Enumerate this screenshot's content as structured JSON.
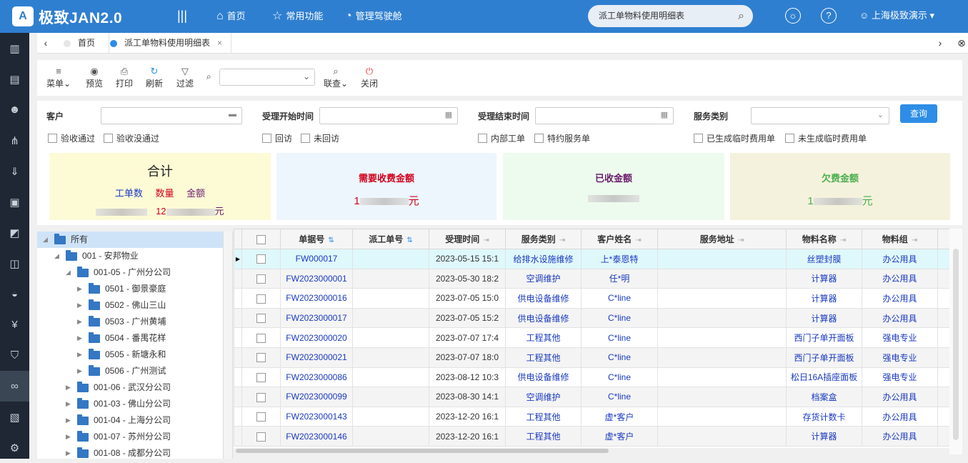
{
  "app": {
    "logo_letter": "A",
    "title": "极致JAN2.0",
    "menu_icon": "menu-lines-icon"
  },
  "topnav": [
    {
      "label": "首页",
      "icon": "home-icon",
      "glyph": "⌂"
    },
    {
      "label": "常用功能",
      "icon": "star-icon",
      "glyph": "☆"
    },
    {
      "label": "管理驾驶舱",
      "icon": "dashboard-icon",
      "glyph": "◔"
    }
  ],
  "search": {
    "value": "派工单物料使用明细表"
  },
  "user": {
    "name": "上海极致演示"
  },
  "sidebar": [
    "building-icon",
    "document-icon",
    "users-icon",
    "share-icon",
    "download-icon",
    "ticket-icon",
    "tag-icon",
    "money-icon",
    "car-icon",
    "yen-icon",
    "shield-icon",
    "link-icon",
    "file-check-icon",
    "gear-icon"
  ],
  "tabs": {
    "home": "首页",
    "current": "派工单物料使用明细表"
  },
  "toolbar": {
    "menu": "菜单",
    "preview": "预览",
    "print": "打印",
    "refresh": "刷新",
    "filter": "过滤",
    "lookup": "联查",
    "close": "关闭"
  },
  "filter": {
    "customer": "客户",
    "start_time": "受理开始时间",
    "end_time": "受理结束时间",
    "service_type": "服务类别",
    "query": "查询",
    "checks": [
      "验收通过",
      "验收没通过",
      "回访",
      "未回访",
      "内部工单",
      "特约服务单",
      "已生成临时费用单",
      "未生成临时费用单"
    ]
  },
  "cards": {
    "total": {
      "title": "合计",
      "work_orders": "工单数",
      "quantity": "数量",
      "amount": "金额",
      "qty_prefix": "12",
      "amount_suffix": "元"
    },
    "receivable": {
      "title": "需要收费金额",
      "prefix": "1",
      "suffix": "元"
    },
    "received": {
      "title": "已收金额"
    },
    "owed": {
      "title": "欠费金额",
      "prefix": "1",
      "suffix": "元"
    }
  },
  "colors": {
    "topbar": "#2f7fd0",
    "card_total": "#fdfbd6",
    "card_receivable": "#eef6fd",
    "card_received": "#edfbee",
    "card_owed": "#f4f2dc",
    "receivable_text": "#d0021b",
    "received_text": "#6a1b6a",
    "owed_text": "#4caf50"
  },
  "tree": [
    {
      "label": "所有",
      "level": 0,
      "expanded": true
    },
    {
      "label": "001 - 安邦物业",
      "level": 1,
      "expanded": true
    },
    {
      "label": "001-05 - 广州分公司",
      "level": 2,
      "expanded": true
    },
    {
      "label": "0501 - 御景豪庭",
      "level": 3
    },
    {
      "label": "0502 - 佛山三山",
      "level": 3
    },
    {
      "label": "0503 - 广州黄埔",
      "level": 3
    },
    {
      "label": "0504 - 番禺花样",
      "level": 3
    },
    {
      "label": "0505 - 新塘永和",
      "level": 3
    },
    {
      "label": "0506 - 广州测试",
      "level": 3
    },
    {
      "label": "001-06 - 武汉分公司",
      "level": 2
    },
    {
      "label": "001-03 - 佛山分公司",
      "level": 2
    },
    {
      "label": "001-04 - 上海分公司",
      "level": 2
    },
    {
      "label": "001-07 - 苏州分公司",
      "level": 2
    },
    {
      "label": "001-08 - 成都分公司",
      "level": 2
    }
  ],
  "grid": {
    "columns": [
      "单据号",
      "派工单号",
      "受理时间",
      "服务类别",
      "客户姓名",
      "服务地址",
      "物料名称",
      "物料组"
    ],
    "rows": [
      {
        "no": "FW000017",
        "dispatch": "",
        "time": "2023-05-15 15:1",
        "type": "给排水设施维修",
        "customer": "上*泰恩特",
        "address": "",
        "material": "丝塑封膜",
        "group": "办公用具"
      },
      {
        "no": "FW2023000001",
        "dispatch": "",
        "time": "2023-05-30 18:2",
        "type": "空调维护",
        "customer": "任*明",
        "address": "",
        "material": "计算器",
        "group": "办公用具"
      },
      {
        "no": "FW2023000016",
        "dispatch": "",
        "time": "2023-07-05 15:0",
        "type": "供电设备维修",
        "customer": "C*line",
        "address": "",
        "material": "计算器",
        "group": "办公用具"
      },
      {
        "no": "FW2023000017",
        "dispatch": "",
        "time": "2023-07-05 15:2",
        "type": "供电设备维修",
        "customer": "C*line",
        "address": "",
        "material": "计算器",
        "group": "办公用具"
      },
      {
        "no": "FW2023000020",
        "dispatch": "",
        "time": "2023-07-07 17:4",
        "type": "工程其他",
        "customer": "C*line",
        "address": "",
        "material": "西门子单开面板",
        "group": "强电专业"
      },
      {
        "no": "FW2023000021",
        "dispatch": "",
        "time": "2023-07-07 18:0",
        "type": "工程其他",
        "customer": "C*line",
        "address": "",
        "material": "西门子单开面板",
        "group": "强电专业"
      },
      {
        "no": "FW2023000086",
        "dispatch": "",
        "time": "2023-08-12 10:3",
        "type": "供电设备维修",
        "customer": "C*line",
        "address": "",
        "material": "松日16A插座面板",
        "group": "强电专业"
      },
      {
        "no": "FW2023000099",
        "dispatch": "",
        "time": "2023-08-30 14:1",
        "type": "空调维护",
        "customer": "C*line",
        "address": "",
        "material": "档案盒",
        "group": "办公用具"
      },
      {
        "no": "FW2023000143",
        "dispatch": "",
        "time": "2023-12-20 16:1",
        "type": "工程其他",
        "customer": "虚*客户",
        "address": "",
        "material": "存货计数卡",
        "group": "办公用具"
      },
      {
        "no": "FW2023000146",
        "dispatch": "",
        "time": "2023-12-20 16:1",
        "type": "工程其他",
        "customer": "虚*客户",
        "address": "",
        "material": "计算器",
        "group": "办公用具"
      }
    ]
  }
}
